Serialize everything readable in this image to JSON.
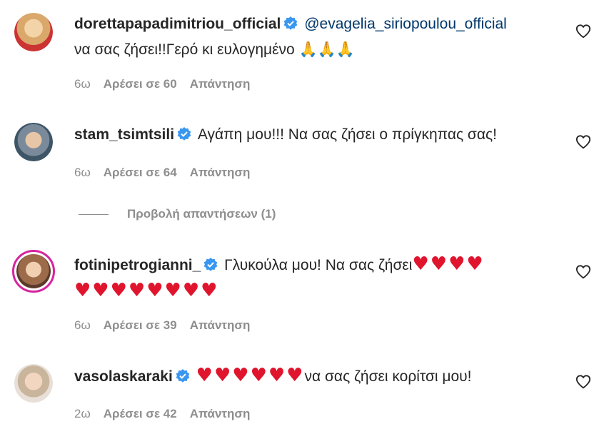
{
  "comments": [
    {
      "username": "dorettapapadimitriou_official",
      "mention": "@evagelia_siriopoulou_official",
      "text": "να σας ζήσει!!Γερό κι ευλογημένο",
      "emoji": "🙏🙏🙏",
      "time": "6ω",
      "likes": "Αρέσει σε 60",
      "reply": "Απάντηση"
    },
    {
      "username": "stam_tsimtsili",
      "text": "Αγάπη μου!!! Να σας ζήσει ο πρίγκηπας σας!",
      "time": "6ω",
      "likes": "Αρέσει σε 64",
      "reply": "Απάντηση",
      "view_replies": "Προβολή απαντήσεων (1)"
    },
    {
      "username": "fotinipetrogianni_",
      "text": "Γλυκούλα μου! Να σας ζήσει",
      "emoji_line1": "♥♥♥♥",
      "emoji_line2": "♥♥♥♥♥♥♥♥",
      "time": "6ω",
      "likes": "Αρέσει σε 39",
      "reply": "Απάντηση"
    },
    {
      "username": "vasolaskaraki",
      "emoji": "♥♥♥♥♥♥",
      "text": "να σας ζήσει κορίτσι μου!",
      "time": "2ω",
      "likes": "Αρέσει σε 42",
      "reply": "Απάντηση"
    }
  ],
  "colors": {
    "verified": "#3897f0",
    "heart_emoji": "#e0152d",
    "story_ring": "#d6249f",
    "mention": "#00376b"
  },
  "icons": {
    "verified": "verified-badge-icon",
    "like": "heart-outline-icon"
  }
}
